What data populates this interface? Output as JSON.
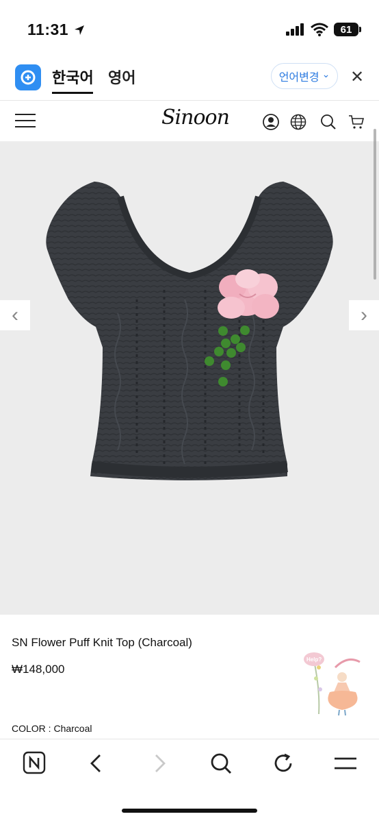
{
  "status": {
    "time": "11:31",
    "battery": "61"
  },
  "translate_bar": {
    "tab_korean": "한국어",
    "tab_english": "영어",
    "change_language": "언어변경",
    "chevron": "⌄",
    "close": "✕"
  },
  "site": {
    "logo": "Sinoon"
  },
  "product": {
    "name": "SN Flower Puff Knit Top (Charcoal)",
    "price": "₩148,000",
    "color_line": "COLOR : Charcoal",
    "help_label": "Help?"
  },
  "icons": {
    "prev_arrow": "‹",
    "next_arrow": "›"
  },
  "colors": {
    "accent_blue": "#2f8ef2",
    "knit_charcoal": "#3a3d42",
    "flower_pink": "#f4b8c6",
    "berry_green": "#3f8a2f",
    "image_bg": "#ececec"
  }
}
